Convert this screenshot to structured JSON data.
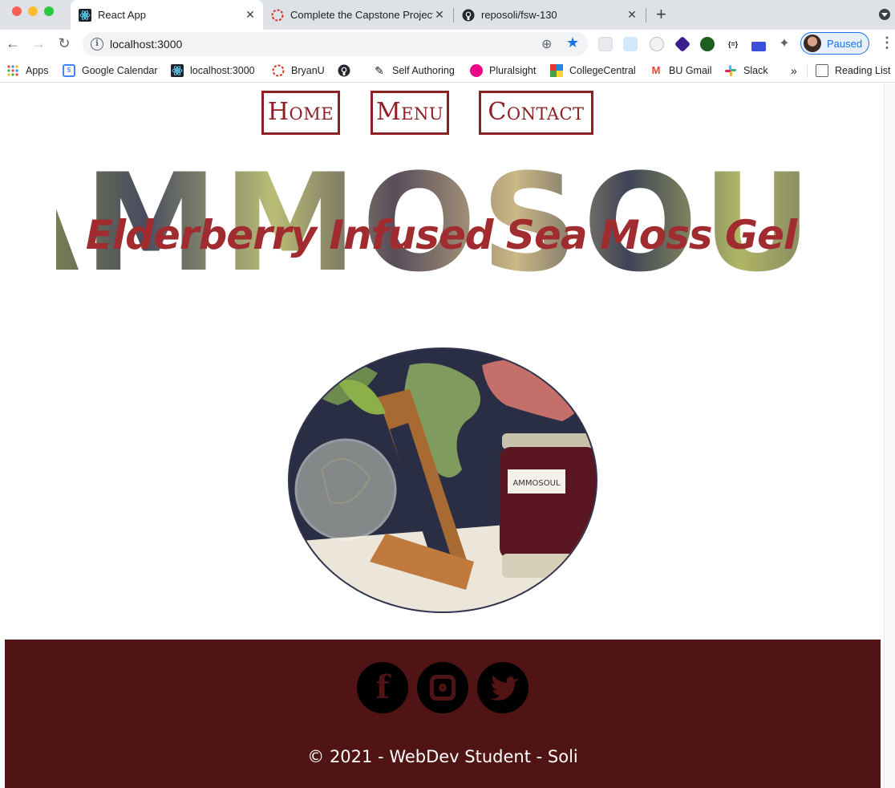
{
  "browser": {
    "tabs": [
      {
        "title": "React App",
        "icon": "react-icon"
      },
      {
        "title": "Complete the Capstone Project",
        "icon": "bryanu-icon"
      },
      {
        "title": "reposoli/fsw-130",
        "icon": "github-icon"
      }
    ],
    "url": "localhost:3000",
    "profile_label": "Paused",
    "bookmarks": [
      {
        "label": "Apps",
        "icon": "apps-grid-icon"
      },
      {
        "label": "Google Calendar",
        "icon": "google-calendar-icon"
      },
      {
        "label": "localhost:3000",
        "icon": "react-icon"
      },
      {
        "label": "BryanU",
        "icon": "bryanu-icon"
      },
      {
        "label": "",
        "icon": "github-icon"
      },
      {
        "label": "Self Authoring",
        "icon": "pen-icon"
      },
      {
        "label": "Pluralsight",
        "icon": "pluralsight-icon"
      },
      {
        "label": "CollegeCentral",
        "icon": "collegecentral-icon"
      },
      {
        "label": "BU Gmail",
        "icon": "gmail-icon"
      },
      {
        "label": "Slack",
        "icon": "slack-icon"
      },
      {
        "label": "Reading List",
        "icon": "reading-list-icon"
      }
    ],
    "overflow_label": "»"
  },
  "nav": {
    "home": "Home",
    "menu": "Menu",
    "contact": "Contact"
  },
  "hero": {
    "brand": "AMMOSOUL",
    "subtitle": "Elderberry Infused Sea Moss Gel",
    "jar_label": "AMMOSOUL"
  },
  "footer": {
    "social": [
      {
        "name": "facebook",
        "glyph": "f"
      },
      {
        "name": "instagram",
        "glyph": "◎"
      },
      {
        "name": "twitter",
        "glyph": "🐦"
      }
    ],
    "copyright": "© 2021 - WebDev Student - Soli"
  },
  "colors": {
    "accent": "#8e1f22",
    "subtitle": "#a12c2f",
    "footer_bg": "#511415",
    "social_bg": "#000000"
  }
}
